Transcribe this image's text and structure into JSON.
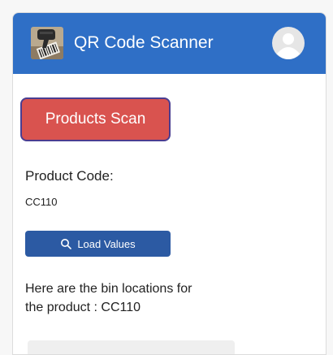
{
  "header": {
    "title": "QR Code Scanner",
    "logo_icon": "barcode-scanner-icon",
    "avatar_icon": "user-avatar-icon",
    "background_color": "#2f6fc6"
  },
  "scan_button": {
    "label": "Products Scan",
    "color": "#d9534f"
  },
  "product": {
    "code_label": "Product Code:",
    "code_value": "CC110"
  },
  "load_button": {
    "label": "Load Values",
    "icon": "search-icon",
    "color": "#2c5aa3"
  },
  "result": {
    "line1": "Here are the bin locations for",
    "line2": "the product : CC110"
  }
}
